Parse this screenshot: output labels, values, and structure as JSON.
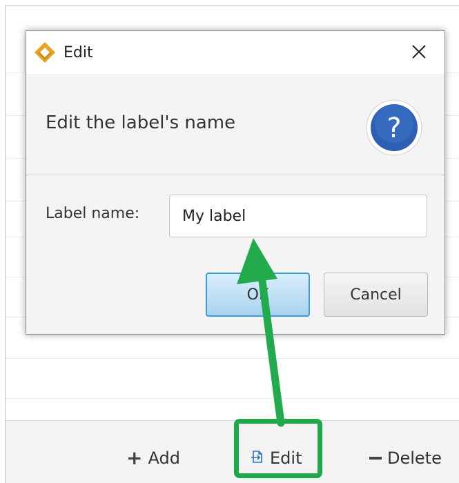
{
  "dialog": {
    "title": "Edit",
    "header": "Edit the label's name",
    "field_label": "Label name:",
    "field_value": "My label",
    "ok_label": "OK",
    "cancel_label": "Cancel"
  },
  "toolbar": {
    "add_label": "Add",
    "edit_label": "Edit",
    "delete_label": "Delete"
  },
  "colors": {
    "highlight": "#1fa84a",
    "help_icon": "#2f5fb3",
    "logo": "#e8a324"
  },
  "icons": [
    "logo-icon",
    "close-icon",
    "question-icon",
    "plus-icon",
    "edit-icon",
    "minus-icon"
  ]
}
